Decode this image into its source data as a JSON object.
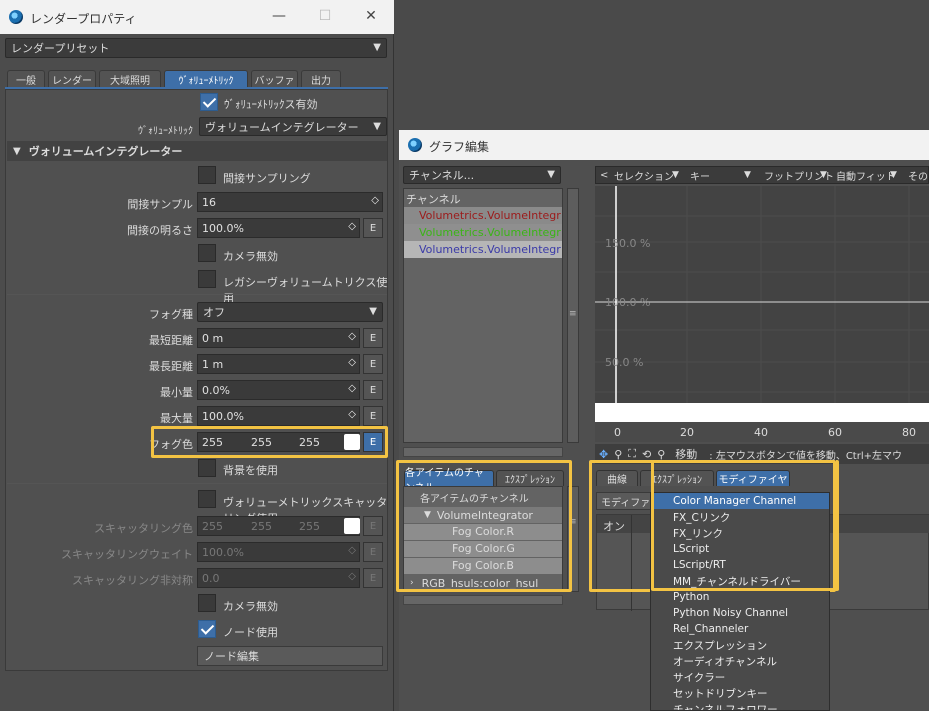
{
  "render_props": {
    "title": "レンダープロパティ",
    "window_controls": {
      "minimize": "—",
      "maximize": "☐",
      "close": "✕"
    },
    "preset": "レンダープリセット",
    "tabs": [
      "一般",
      "レンダー",
      "大域照明",
      "ｳﾞｫﾘｭｰﾒﾄﾘｯｸ",
      "バッファ",
      "出力"
    ],
    "active_tab": "ｳﾞｫﾘｭｰﾒﾄﾘｯｸ",
    "volumetrics_enabled": "ｳﾞｫﾘｭｰﾒﾄﾘｯｸス有効",
    "volumetric_label": "ｳﾞｫﾘｭｰﾒﾄﾘｯｸ",
    "volumetric_value": "ヴォリュームインテグレーター",
    "section_title": "ヴォリュームインテグレーター",
    "indirect_sampling": "間接サンプリング",
    "indirect_samples_label": "間接サンプル",
    "indirect_samples_value": "16",
    "indirect_brightness_label": "間接の明るさ",
    "indirect_brightness_value": "100.0%",
    "camera_disable": "カメラ無効",
    "legacy_volumetrics": "レガシーヴォリュームトリクス使用",
    "fog_type_label": "フォグ種",
    "fog_type_value": "オフ",
    "min_distance_label": "最短距離",
    "min_distance_value": "0 m",
    "max_distance_label": "最長距離",
    "max_distance_value": "1 m",
    "min_amount_label": "最小量",
    "min_amount_value": "0.0%",
    "max_amount_label": "最大量",
    "max_amount_value": "100.0%",
    "fog_color_label": "フォグ色",
    "fog_color_r": "255",
    "fog_color_g": "255",
    "fog_color_b": "255",
    "use_background": "背景を使用",
    "scattering_use": "ヴォリューメトリックスキャッタリング使用",
    "scatter_color_label": "スキャッタリング色",
    "scatter_color_r": "255",
    "scatter_color_g": "255",
    "scatter_color_b": "255",
    "scatter_weight_label": "スキャッタリングウェイト",
    "scatter_weight_value": "100.0%",
    "scatter_asym_label": "スキャッタリング非対称",
    "scatter_asym_value": "0.0",
    "camera_disable2": "カメラ無効",
    "use_nodes": "ノード使用",
    "edit_nodes": "ノード編集",
    "env_btn": "E"
  },
  "graph_editor": {
    "title": "グラフ編集",
    "channel_dropdown": "チャンネル...",
    "channel_header": "チャンネル",
    "channels": [
      "Volumetrics.VolumeIntegr",
      "Volumetrics.VolumeIntegr",
      "Volumetrics.VolumeIntegr"
    ],
    "channel_colors": [
      "#9c1a1a",
      "#3ab515",
      "#3a3aa8"
    ],
    "toolbar": [
      "セレクション",
      "キー",
      "フットプリント",
      "自動フィット",
      "その"
    ],
    "y_labels": [
      "150.0 %",
      "100.0 %",
      "50.0 %"
    ],
    "x_labels": [
      "0",
      "20",
      "40",
      "60",
      "80"
    ],
    "status_mode": "移動",
    "status_text": ":  左マウスボタンで値を移動、Ctrl+左マウ",
    "bottom_tabs": [
      "各アイテムのチャンネル",
      "ｴｸｽﾌﾟﾚｯｼｮﾝ"
    ],
    "tree_header": "各アイテムのチャンネル",
    "tree_group": "VolumeIntegrator",
    "tree_items": [
      "Fog Color.R",
      "Fog Color.G",
      "Fog Color.B"
    ],
    "tree_more": "RGB_hsuls:color_hsul",
    "right_tabs": [
      "曲線",
      "ｴｸｽﾌﾟﾚｯｼｮﾝ",
      "モディファイヤ"
    ],
    "modifier_btn": "モディファイヤ",
    "table_header_on": "オン"
  },
  "modifier_menu": {
    "items": [
      "Color Manager Channel",
      "FX_Cリンク",
      "FX_リンク",
      "LScript",
      "LScript/RT",
      "MM_チャンネルドライバー",
      "Python",
      "Python Noisy Channel",
      "Rel_Channeler",
      "エクスプレッション",
      "オーディオチャンネル",
      "サイクラー",
      "セットドリブンキー",
      "チャンネルフォロワー"
    ],
    "highlighted": "Color Manager Channel"
  },
  "colors": {
    "accent": "#3e6fa8",
    "highlight": "#f3c343"
  }
}
